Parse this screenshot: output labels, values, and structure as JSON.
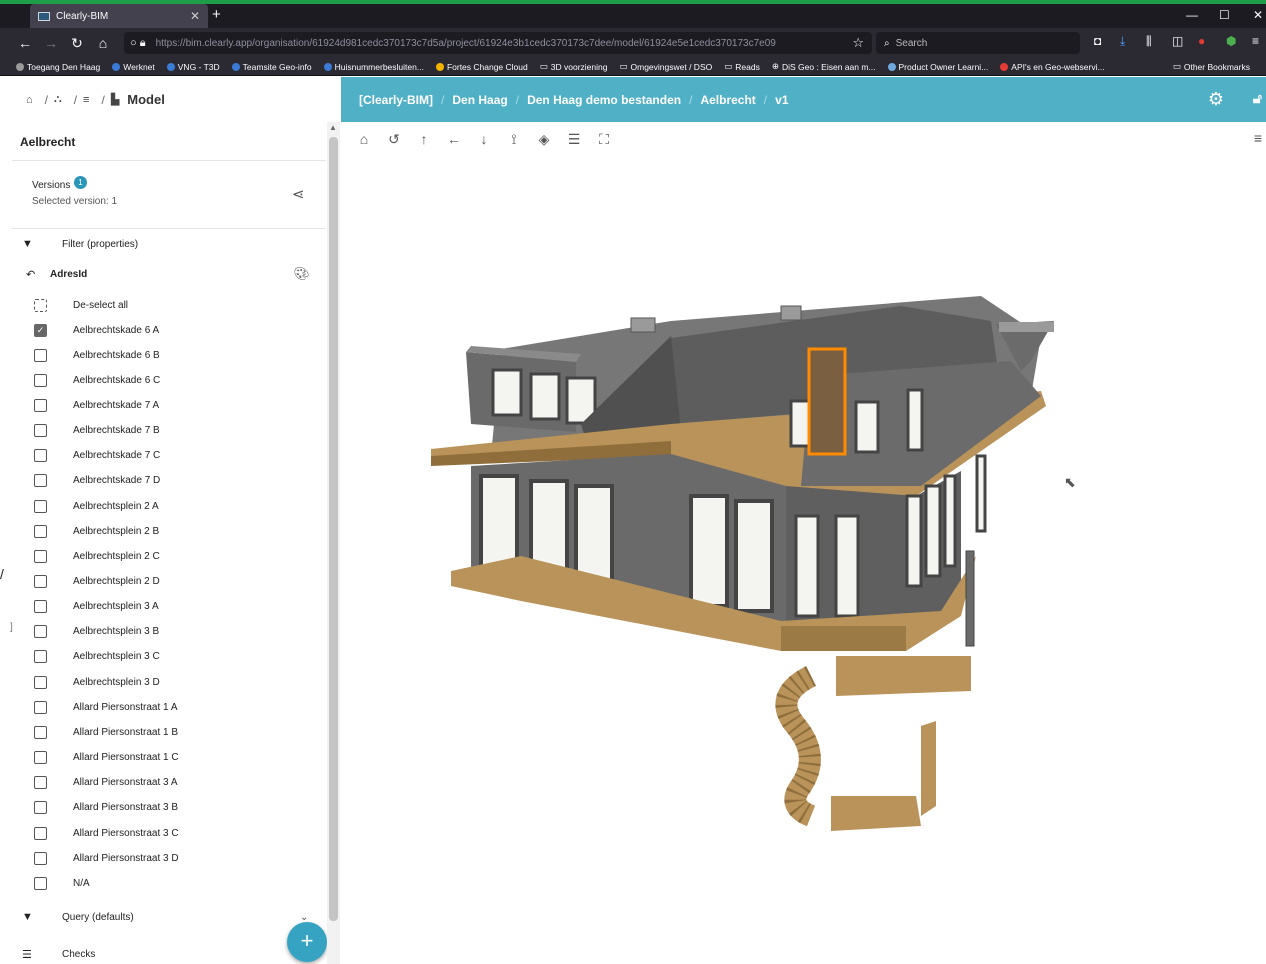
{
  "browser": {
    "tab_title": "Clearly-BIM",
    "new_tab": "+",
    "url": "https://bim.clearly.app/organisation/61924d981cedc370173c7d5a/project/61924e3b1cedc370173c7dee/model/61924e5e1cedc370173c7e09",
    "search_placeholder": "Search",
    "bookmarks": [
      "Toegang Den Haag",
      "Werknet",
      "VNG - T3D",
      "Teamsite Geo-info",
      "Huisnummerbesluiten...",
      "Fortes Change Cloud",
      "3D voorziening",
      "Omgevingswet / DSO",
      "Reads",
      "DiS Geo : Eisen aan m...",
      "Product Owner Learni...",
      "API's en Geo-webservi..."
    ],
    "other_bookmarks": "Other Bookmarks"
  },
  "header": {
    "model_label": "Model",
    "breadcrumb": [
      "[Clearly-BIM]",
      "Den Haag",
      "Den Haag demo bestanden",
      "Aelbrecht",
      "v1"
    ]
  },
  "sidebar": {
    "title": "Aelbrecht",
    "versions_label": "Versions",
    "versions_badge": "1",
    "selected_version": "Selected version: 1",
    "filter_label": "Filter (properties)",
    "adres_label": "AdresId",
    "deselect_label": "De-select all",
    "items": [
      {
        "label": "Aelbrechtskade 6 A",
        "checked": true
      },
      {
        "label": "Aelbrechtskade 6 B",
        "checked": false
      },
      {
        "label": "Aelbrechtskade 6 C",
        "checked": false
      },
      {
        "label": "Aelbrechtskade 7 A",
        "checked": false
      },
      {
        "label": "Aelbrechtskade 7 B",
        "checked": false
      },
      {
        "label": "Aelbrechtskade 7 C",
        "checked": false
      },
      {
        "label": "Aelbrechtskade 7 D",
        "checked": false
      },
      {
        "label": "Aelbrechtsplein 2 A",
        "checked": false
      },
      {
        "label": "Aelbrechtsplein 2 B",
        "checked": false
      },
      {
        "label": "Aelbrechtsplein 2 C",
        "checked": false
      },
      {
        "label": "Aelbrechtsplein 2 D",
        "checked": false
      },
      {
        "label": "Aelbrechtsplein 3 A",
        "checked": false
      },
      {
        "label": "Aelbrechtsplein 3 B",
        "checked": false
      },
      {
        "label": "Aelbrechtsplein 3 C",
        "checked": false
      },
      {
        "label": "Aelbrechtsplein 3 D",
        "checked": false
      },
      {
        "label": "Allard Piersonstraat 1 A",
        "checked": false
      },
      {
        "label": "Allard Piersonstraat 1 B",
        "checked": false
      },
      {
        "label": "Allard Piersonstraat 1 C",
        "checked": false
      },
      {
        "label": "Allard Piersonstraat 3 A",
        "checked": false
      },
      {
        "label": "Allard Piersonstraat 3 B",
        "checked": false
      },
      {
        "label": "Allard Piersonstraat 3 C",
        "checked": false
      },
      {
        "label": "Allard Piersonstraat 3 D",
        "checked": false
      },
      {
        "label": "N/A",
        "checked": false
      }
    ],
    "query_label": "Query (defaults)",
    "checks_label": "Checks",
    "fab_label": "+"
  },
  "colors": {
    "header_accent": "#4fb0c6",
    "fab": "#35a3c1",
    "selection_highlight": "#ff8c00",
    "wall_gray": "#6e6e6e",
    "floor_wood": "#b9935a"
  },
  "viewer_toolbar_icons": [
    "home-icon",
    "history-icon",
    "arrow-up-icon",
    "arrow-left-icon",
    "arrow-down-icon",
    "measure-icon",
    "layers-icon",
    "filter-icon",
    "fullscreen-icon"
  ]
}
